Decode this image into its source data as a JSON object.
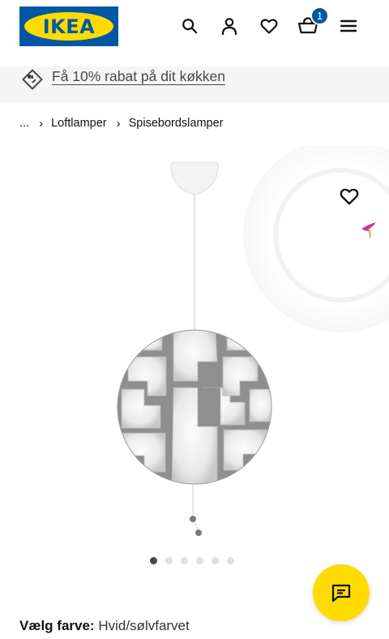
{
  "header": {
    "logo_text": "IKEA",
    "icons": [
      "search-icon",
      "profile-icon",
      "heart-icon",
      "cart-icon",
      "menu-icon"
    ],
    "cart_count": "1"
  },
  "promo": {
    "text": "Få 10% rabat på dit køkken",
    "icon": "price-tag-icon"
  },
  "breadcrumb": {
    "ellipsis": "...",
    "items": [
      "Loftlamper",
      "Spisebordslamper"
    ]
  },
  "gallery": {
    "image_count": 6,
    "active_index": 0
  },
  "product": {
    "color_label": "Vælg farve:",
    "color_value": "Hvid/sølvfarvet"
  },
  "colors": {
    "ikea_blue": "#0058a3",
    "ikea_yellow": "#ffdb00",
    "promo_bg": "#f5f5f5"
  }
}
